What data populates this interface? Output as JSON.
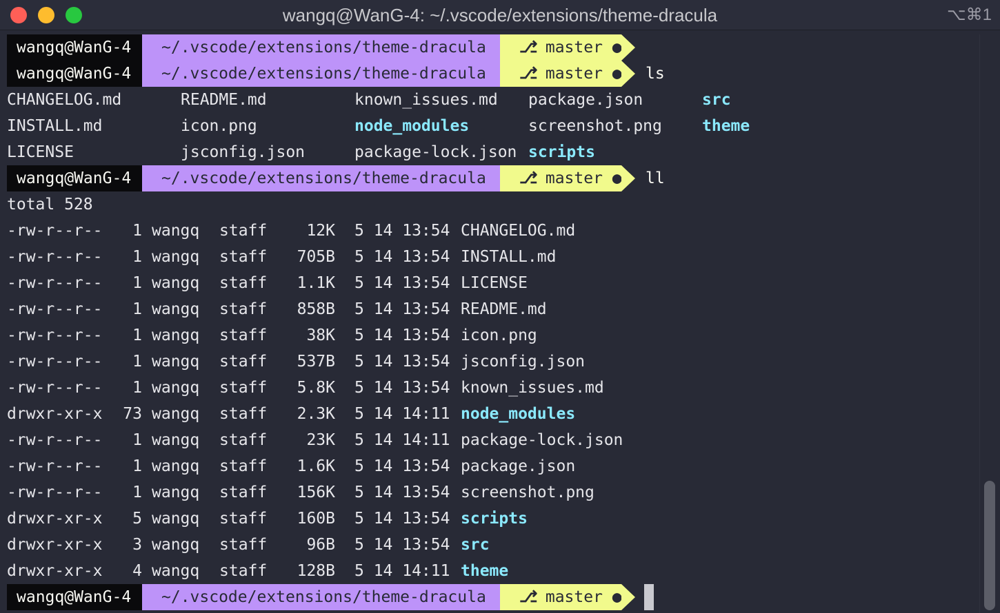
{
  "window": {
    "title": "wangq@WanG-4: ~/.vscode/extensions/theme-dracula",
    "shortcut": "⌥⌘1"
  },
  "prompt": {
    "user": "wangq@WanG-4",
    "path": "~/.vscode/extensions/theme-dracula",
    "branch": "master",
    "branch_icon": "",
    "dirty_marker": "●"
  },
  "commands": {
    "first": "",
    "ls": "ls",
    "ll": "ll"
  },
  "ls_output": [
    [
      "CHANGELOG.md",
      "README.md",
      "known_issues.md",
      "package.json",
      "src"
    ],
    [
      "INSTALL.md",
      "icon.png",
      "node_modules",
      "screenshot.png",
      "theme"
    ],
    [
      "LICENSE",
      "jsconfig.json",
      "package-lock.json",
      "scripts",
      ""
    ]
  ],
  "ls_dirs": [
    "src",
    "node_modules",
    "theme",
    "scripts"
  ],
  "ll_total": "total 528",
  "ll_rows": [
    {
      "perms": "-rw-r--r--",
      "links": "1",
      "owner": "wangq",
      "group": "staff",
      "size": "12K",
      "date": "5 14 13:54",
      "name": "CHANGELOG.md",
      "dir": false
    },
    {
      "perms": "-rw-r--r--",
      "links": "1",
      "owner": "wangq",
      "group": "staff",
      "size": "705B",
      "date": "5 14 13:54",
      "name": "INSTALL.md",
      "dir": false
    },
    {
      "perms": "-rw-r--r--",
      "links": "1",
      "owner": "wangq",
      "group": "staff",
      "size": "1.1K",
      "date": "5 14 13:54",
      "name": "LICENSE",
      "dir": false
    },
    {
      "perms": "-rw-r--r--",
      "links": "1",
      "owner": "wangq",
      "group": "staff",
      "size": "858B",
      "date": "5 14 13:54",
      "name": "README.md",
      "dir": false
    },
    {
      "perms": "-rw-r--r--",
      "links": "1",
      "owner": "wangq",
      "group": "staff",
      "size": "38K",
      "date": "5 14 13:54",
      "name": "icon.png",
      "dir": false
    },
    {
      "perms": "-rw-r--r--",
      "links": "1",
      "owner": "wangq",
      "group": "staff",
      "size": "537B",
      "date": "5 14 13:54",
      "name": "jsconfig.json",
      "dir": false
    },
    {
      "perms": "-rw-r--r--",
      "links": "1",
      "owner": "wangq",
      "group": "staff",
      "size": "5.8K",
      "date": "5 14 13:54",
      "name": "known_issues.md",
      "dir": false
    },
    {
      "perms": "drwxr-xr-x",
      "links": "73",
      "owner": "wangq",
      "group": "staff",
      "size": "2.3K",
      "date": "5 14 14:11",
      "name": "node_modules",
      "dir": true
    },
    {
      "perms": "-rw-r--r--",
      "links": "1",
      "owner": "wangq",
      "group": "staff",
      "size": "23K",
      "date": "5 14 14:11",
      "name": "package-lock.json",
      "dir": false
    },
    {
      "perms": "-rw-r--r--",
      "links": "1",
      "owner": "wangq",
      "group": "staff",
      "size": "1.6K",
      "date": "5 14 13:54",
      "name": "package.json",
      "dir": false
    },
    {
      "perms": "-rw-r--r--",
      "links": "1",
      "owner": "wangq",
      "group": "staff",
      "size": "156K",
      "date": "5 14 13:54",
      "name": "screenshot.png",
      "dir": false
    },
    {
      "perms": "drwxr-xr-x",
      "links": "5",
      "owner": "wangq",
      "group": "staff",
      "size": "160B",
      "date": "5 14 13:54",
      "name": "scripts",
      "dir": true
    },
    {
      "perms": "drwxr-xr-x",
      "links": "3",
      "owner": "wangq",
      "group": "staff",
      "size": "96B",
      "date": "5 14 13:54",
      "name": "src",
      "dir": true
    },
    {
      "perms": "drwxr-xr-x",
      "links": "4",
      "owner": "wangq",
      "group": "staff",
      "size": "128B",
      "date": "5 14 14:11",
      "name": "theme",
      "dir": true
    }
  ],
  "colors": {
    "background": "#282a36",
    "prompt_user_bg": "#0a0a0c",
    "prompt_path_bg": "#bd93f9",
    "prompt_git_bg": "#f1fa8c",
    "directory": "#8be9fd",
    "text": "#e6e6ea"
  },
  "icons": {
    "close": "close-traffic-light-icon",
    "minimize": "minimize-traffic-light-icon",
    "zoom": "zoom-traffic-light-icon",
    "branch": "git-branch-icon",
    "dirty": "dirty-dot-icon"
  }
}
